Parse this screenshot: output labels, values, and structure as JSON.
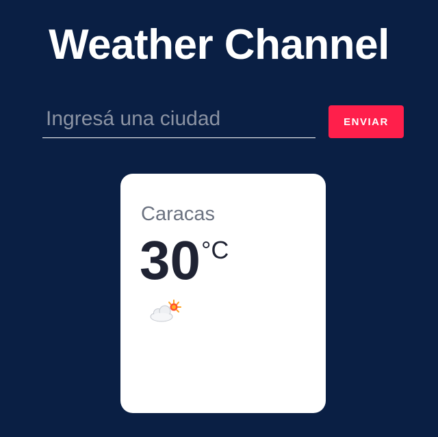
{
  "header": {
    "title": "Weather Channel"
  },
  "search": {
    "placeholder": "Ingresá una ciudad",
    "value": "",
    "submit_label": "ENVIAR"
  },
  "weather": {
    "city": "Caracas",
    "temperature": "30",
    "unit": "°C",
    "icon": "partly-sunny-cloud-icon"
  },
  "colors": {
    "background": "#0a1f44",
    "accent": "#ff1f4b",
    "card": "#ffffff"
  }
}
